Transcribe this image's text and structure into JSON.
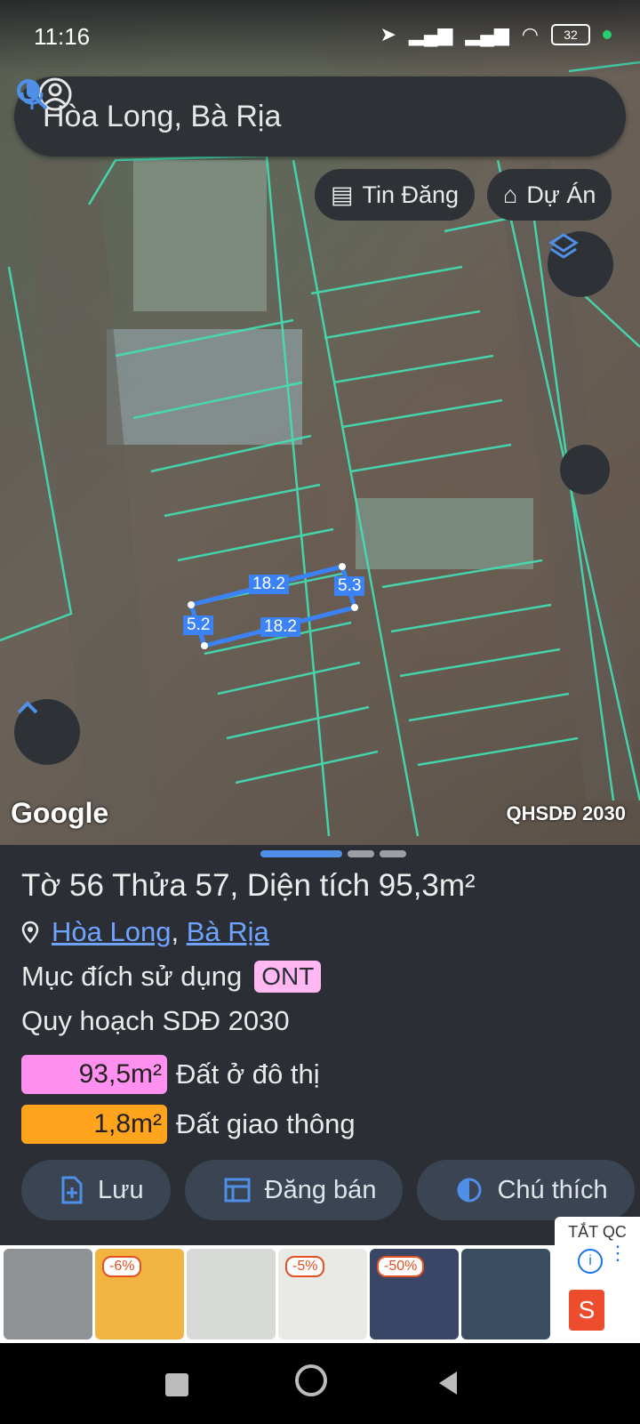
{
  "status": {
    "time": "11:16",
    "battery": "32"
  },
  "search": {
    "query": "Hòa Long, Bà Rịa"
  },
  "chips": {
    "listing": "Tin Đăng",
    "project": "Dự Án"
  },
  "map": {
    "measurements": {
      "top": "18.2",
      "bottom": "18.2",
      "left": "5.2",
      "right": "5.3"
    },
    "watermark": "Google",
    "layer_label": "QHSDĐ 2030",
    "parcel_line_color": "#43e0b5",
    "selection_color": "#3b82f6"
  },
  "sheet": {
    "title": "Tờ 56 Thửa 57, Diện tích 95,3m²",
    "ward": "Hòa Long",
    "separator": ",",
    "city": "Bà Rịa",
    "purpose_label": "Mục đích sử dụng",
    "purpose_code": "ONT",
    "plan_label": "Quy hoạch SDĐ 2030",
    "areas": [
      {
        "value": "93,5m²",
        "label": "Đất ở đô thị",
        "color": "#ff90f0"
      },
      {
        "value": "1,8m²",
        "label": "Đất giao thông",
        "color": "#ffa41c"
      }
    ],
    "actions": {
      "save": "Lưu",
      "post": "Đăng bán",
      "legend": "Chú thích"
    }
  },
  "ad": {
    "close_label": "TẮT QC",
    "discounts": [
      "-6%",
      "-5%",
      "-50%"
    ]
  }
}
